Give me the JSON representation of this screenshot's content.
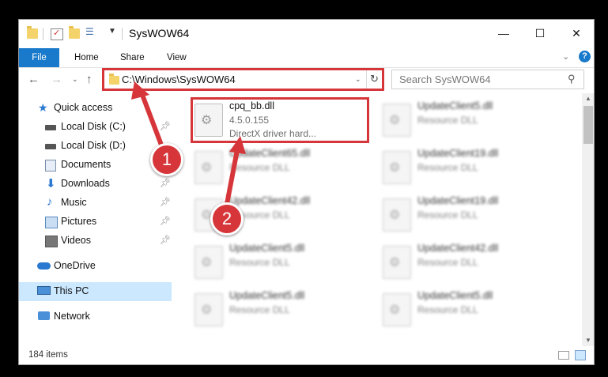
{
  "window": {
    "title": "SysWOW64",
    "controls": {
      "minimize": "—",
      "maximize": "☐",
      "close": "✕"
    }
  },
  "ribbon": {
    "tabs": [
      "File",
      "Home",
      "Share",
      "View"
    ],
    "expand_icon": "chevron-down-icon",
    "help_icon": "help-icon"
  },
  "address_bar": {
    "path": "C:\\Windows\\SysWOW64"
  },
  "search": {
    "placeholder": "Search SysWOW64"
  },
  "nav_pane": {
    "items": [
      {
        "label": "Quick access",
        "icon": "star-icon"
      },
      {
        "label": "Local Disk (C:)",
        "icon": "drive-icon",
        "pinned": true
      },
      {
        "label": "Local Disk (D:)",
        "icon": "drive-icon"
      },
      {
        "label": "Documents",
        "icon": "documents-icon",
        "pinned": true
      },
      {
        "label": "Downloads",
        "icon": "downloads-icon",
        "pinned": true
      },
      {
        "label": "Music",
        "icon": "music-icon",
        "pinned": true
      },
      {
        "label": "Pictures",
        "icon": "pictures-icon",
        "pinned": true
      },
      {
        "label": "Videos",
        "icon": "videos-icon",
        "pinned": true
      },
      {
        "label": "OneDrive",
        "icon": "cloud-icon"
      },
      {
        "label": "This PC",
        "icon": "computer-icon",
        "selected": true
      },
      {
        "label": "Network",
        "icon": "network-icon"
      }
    ]
  },
  "files": [
    {
      "name": "cpq_bb.dll",
      "line2": "4.5.0.155",
      "line3": "DirectX driver hard...",
      "highlighted": true
    },
    {
      "name": "UpdateClient5.dll",
      "line2": "Resource DLL"
    },
    {
      "name": "UpdateClient65.dll",
      "line2": "Resource DLL"
    },
    {
      "name": "UpdateClient19.dll",
      "line2": "Resource DLL"
    },
    {
      "name": "UpdateClient42.dll",
      "line2": "Resource DLL"
    },
    {
      "name": "UpdateClient19.dll",
      "line2": "Resource DLL"
    },
    {
      "name": "UpdateClient5.dll",
      "line2": "Resource DLL"
    },
    {
      "name": "UpdateClient42.dll",
      "line2": "Resource DLL"
    },
    {
      "name": "UpdateClient5.dll",
      "line2": "Resource DLL"
    },
    {
      "name": "UpdateClient5.dll",
      "line2": "Resource DLL"
    }
  ],
  "status_bar": {
    "items_count": "184 items"
  },
  "callouts": [
    {
      "label": "1"
    },
    {
      "label": "2"
    }
  ],
  "colors": {
    "accent": "#1979ca",
    "annotation_red": "#d6363a",
    "selected_nav": "#cce8ff"
  }
}
